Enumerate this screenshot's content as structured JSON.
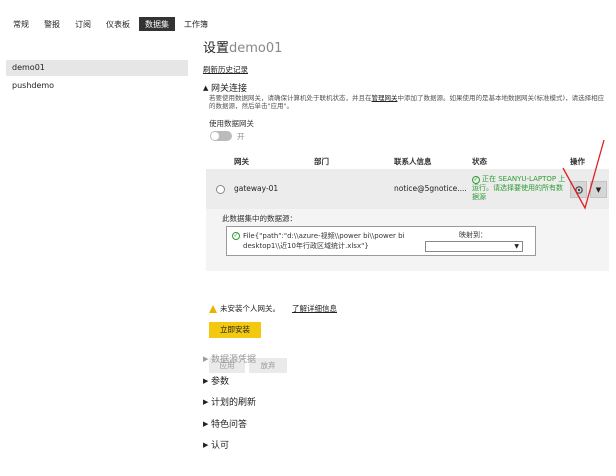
{
  "tabs": [
    {
      "label": "常规",
      "active": false
    },
    {
      "label": "警报",
      "active": false
    },
    {
      "label": "订阅",
      "active": false
    },
    {
      "label": "仪表板",
      "active": false
    },
    {
      "label": "数据集",
      "active": true
    },
    {
      "label": "工作簿",
      "active": false
    }
  ],
  "sidebar": {
    "items": [
      {
        "label": "demo01",
        "active": true
      },
      {
        "label": "pushdemo",
        "active": false
      }
    ]
  },
  "main": {
    "title_prefix": "设置",
    "title_dataset": "demo01",
    "refresh_history_link": "刷新历史记录",
    "gateway": {
      "heading": "网关连接",
      "description_pre": "若要使用数据网关，请确保计算机处于联机状态，并且在",
      "manage_gateway_link": "管理网关",
      "description_post": "中添加了数据源。如果使用的是基本地数据网关(标准模式)，请选择相应的数据源，然后单击\"应用\"。",
      "use_gateway_label": "使用数据网关",
      "toggle_state_label": "开",
      "toggle_on": false,
      "columns": {
        "gateway": "网关",
        "department": "部门",
        "contact": "联系人信息",
        "status": "状态",
        "actions": "操作"
      },
      "row": {
        "name": "gateway-01",
        "department": "",
        "contact": "notice@5gnotice....",
        "status": "正在 SEANYU-LAPTOP 上运行。请选择要使用的所有数据源"
      },
      "datasource_section_title": "此数据集中的数据源：",
      "datasource": {
        "path": "File{\"path\":\"d:\\\\azure-视频\\\\power bi\\\\power bi desktop1\\\\近10年行政区域统计.xlsx\"}",
        "map_label": "映射到：",
        "map_value": ""
      }
    },
    "warning": {
      "text": "未安装个人网关。",
      "learn_more": "了解详细信息"
    },
    "install_button": "立即安装",
    "apply_button": "应用",
    "discard_button": "放弃",
    "sections": [
      {
        "label": "数据源凭据",
        "muted": true
      },
      {
        "label": "参数",
        "muted": false
      },
      {
        "label": "计划的刷新",
        "muted": false
      },
      {
        "label": "特色问答",
        "muted": false
      },
      {
        "label": "认可",
        "muted": false
      }
    ]
  },
  "colors": {
    "active_tab": "#333333",
    "install_button": "#f2c811",
    "status_green": "#2e9c35",
    "annotation_red": "#e02020"
  },
  "icons": {
    "status": "check-circle-icon",
    "gear": "gear-icon",
    "menu": "chevron-down-icon",
    "warning": "warning-icon"
  }
}
